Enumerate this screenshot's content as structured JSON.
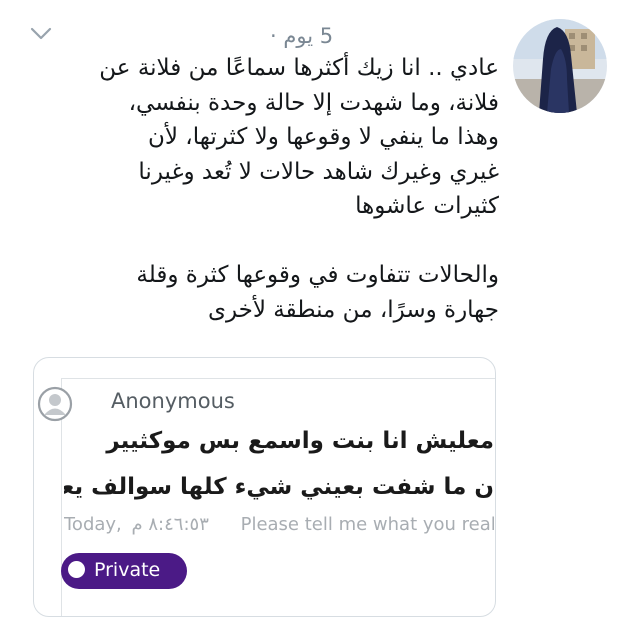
{
  "tweet": {
    "meta": "5 يوم ·",
    "avatar_icon": "avatar-photo",
    "menu_icon": "chevron-down-icon",
    "lines": [
      "عادي .. انا زيك أكثرها سماعًا من فلانة عن",
      "فلانة، وما شهدت إلا حالة وحدة بنفسي،",
      "وهذا ما ينفي لا وقوعها ولا كثرتها، لأن",
      "غيري وغيرك شاهد حالات لا تُعد وغيرنا",
      "كثيرات عاشوها",
      "",
      "والحالات تتفاوت في وقوعها كثرة وقلة",
      "جهارة وسرًا، من منطقة لأخرى"
    ]
  },
  "card": {
    "author": "Anonymous",
    "author_icon": "anonymous-user-icon",
    "question_line1": "معليش انا بنت واسمع بس موكثيير",
    "question_line2": "ن ما شفت بعيني شيء كلها سوالف يعني",
    "timestamp_label": "Today,",
    "timestamp_time": "٨:٤٦:٥٣ م",
    "hint": "Please tell me what you really",
    "private_label": "Private",
    "accent_color": "#4b1a86"
  }
}
